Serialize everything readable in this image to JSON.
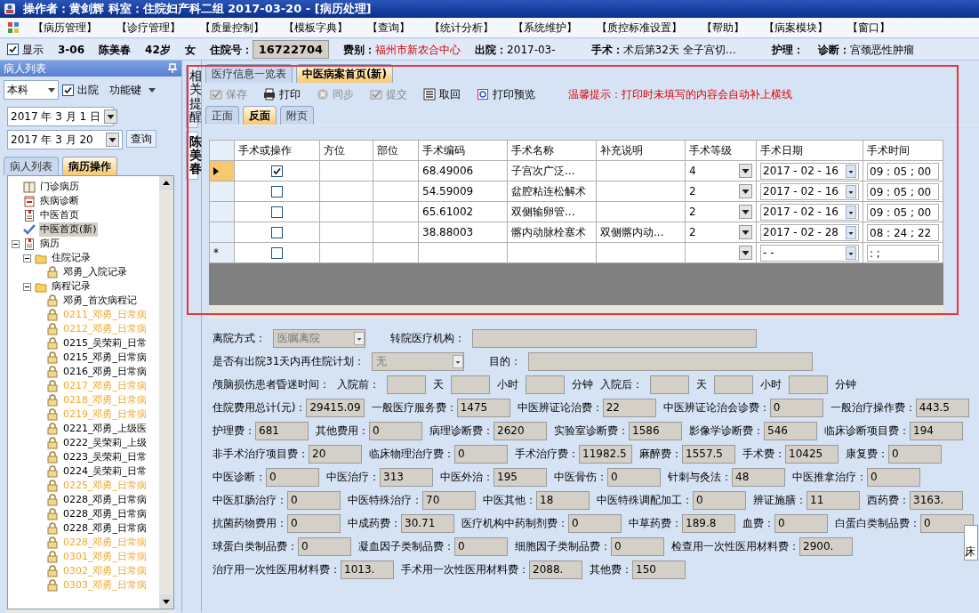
{
  "window": {
    "title": "操作者：黄剑辉  科室：住院妇产科二组  2017-03-20 - [病历处理]"
  },
  "menu": [
    "【病历管理】",
    "【诊疗管理】",
    "【质量控制】",
    "【模板字典】",
    "【查询】",
    "【统计分析】",
    "【系统维护】",
    "【质控标准设置】",
    "【帮助】",
    "【病案模块】",
    "【窗口】"
  ],
  "patient_bar": {
    "show": {
      "label": "显示",
      "checked": true
    },
    "bed": "3-06",
    "name": "陈美春",
    "age": "42岁",
    "sex": "女",
    "fields": [
      {
        "label": "住院号：",
        "value": "16722704",
        "kind": "box"
      },
      {
        "label": "费别：",
        "value": "福州市新农合中心",
        "kind": "alert"
      },
      {
        "label": "出院：",
        "value": "2017-03-",
        "kind": "text"
      },
      {
        "label": "手术：",
        "value": "术后第32天  全子宫切…",
        "kind": "text"
      },
      {
        "label": "护理：",
        "kind": "text"
      },
      {
        "label": "诊断：",
        "value": "宫颈恶性肿瘤",
        "kind": "text"
      }
    ]
  },
  "left_panel": {
    "title": "病人列表",
    "department": "本科",
    "discharged": {
      "label": "出院",
      "checked": true
    },
    "function_key": "功能键",
    "date_from": "2017 年 3 月 1 日",
    "date_to": "2017 年 3 月 20",
    "query": "查询",
    "tabs": [
      {
        "label": "病人列表",
        "selected": false
      },
      {
        "label": "病历操作",
        "selected": true
      }
    ],
    "tree": [
      {
        "text": "门诊病历",
        "kind": "book",
        "highlighted": false,
        "selected": false
      },
      {
        "text": "疾病诊断",
        "kind": "calendar",
        "highlighted": false,
        "selected": false
      },
      {
        "text": "中医首页",
        "kind": "doc",
        "highlighted": false,
        "selected": false
      },
      {
        "text": "中医首页(新)",
        "kind": "check",
        "highlighted": false,
        "selected": true
      },
      {
        "text": "病历",
        "kind": "doc",
        "highlighted": false,
        "selected": false,
        "expanded": true,
        "children": [
          {
            "text": "住院记录",
            "kind": "folder",
            "highlighted": false,
            "selected": false,
            "expanded": true,
            "children": [
              {
                "text": "邓勇_入院记录",
                "kind": "lock",
                "highlighted": false,
                "selected": false
              }
            ]
          },
          {
            "text": "病程记录",
            "kind": "folder",
            "highlighted": false,
            "selected": false,
            "expanded": true,
            "children": [
              {
                "text": "邓勇_首次病程记",
                "kind": "lock",
                "highlighted": false,
                "selected": false
              },
              {
                "text": "0211_邓勇_日常病",
                "kind": "lock",
                "highlighted": true,
                "selected": false
              },
              {
                "text": "0212_邓勇_日常病",
                "kind": "lock",
                "highlighted": true,
                "selected": false
              },
              {
                "text": "0215_吴荣莉_日常",
                "kind": "lock",
                "highlighted": false,
                "selected": false
              },
              {
                "text": "0215_邓勇_日常病",
                "kind": "lock",
                "highlighted": false,
                "selected": false
              },
              {
                "text": "0216_邓勇_日常病",
                "kind": "lock",
                "highlighted": false,
                "selected": false
              },
              {
                "text": "0217_邓勇_日常病",
                "kind": "lock",
                "highlighted": true,
                "selected": false
              },
              {
                "text": "0218_邓勇_日常病",
                "kind": "lock",
                "highlighted": true,
                "selected": false
              },
              {
                "text": "0219_邓勇_日常病",
                "kind": "lock",
                "highlighted": true,
                "selected": false
              },
              {
                "text": "0221_邓勇_上级医",
                "kind": "lock",
                "highlighted": false,
                "selected": false
              },
              {
                "text": "0222_吴荣莉_上级",
                "kind": "lock",
                "highlighted": false,
                "selected": false
              },
              {
                "text": "0223_吴荣莉_日常",
                "kind": "lock",
                "highlighted": false,
                "selected": false
              },
              {
                "text": "0224_吴荣莉_日常",
                "kind": "lock",
                "highlighted": false,
                "selected": false
              },
              {
                "text": "0225_邓勇_日常病",
                "kind": "lock",
                "highlighted": true,
                "selected": false
              },
              {
                "text": "0228_邓勇_日常病",
                "kind": "lock",
                "highlighted": false,
                "selected": false
              },
              {
                "text": "0228_邓勇_日常病",
                "kind": "lock",
                "highlighted": false,
                "selected": false
              },
              {
                "text": "0228_邓勇_日常病",
                "kind": "lock",
                "highlighted": false,
                "selected": false
              },
              {
                "text": "0228_邓勇_日常病",
                "kind": "lock",
                "highlighted": true,
                "selected": false
              },
              {
                "text": "0301_邓勇_日常病",
                "kind": "lock",
                "highlighted": true,
                "selected": false
              },
              {
                "text": "0302_邓勇_日常病",
                "kind": "lock",
                "highlighted": true,
                "selected": false
              },
              {
                "text": "0303_邓勇_日常病",
                "kind": "lock",
                "highlighted": true,
                "selected": false
              }
            ]
          }
        ]
      }
    ]
  },
  "side_tabs": [
    {
      "label": "相关提醒",
      "selected": false
    },
    {
      "label": "陈美春",
      "selected": true
    }
  ],
  "tabs": [
    {
      "label": "医疗信息一览表",
      "selected": false
    },
    {
      "label": "中医病案首页(新)",
      "selected": true
    }
  ],
  "toolbar": [
    {
      "label": "保存",
      "kind": "save",
      "disabled": true
    },
    {
      "label": "打印",
      "kind": "print",
      "disabled": false
    },
    {
      "label": "同步",
      "kind": "sync",
      "disabled": true
    },
    {
      "label": "提交",
      "kind": "save",
      "disabled": true
    },
    {
      "label": "取回",
      "kind": "fetch",
      "disabled": false
    },
    {
      "label": "打印预览",
      "kind": "preview",
      "disabled": false
    }
  ],
  "tip": "温馨提示：打印时未填写的内容会自动补上横线",
  "subtabs": [
    {
      "label": "正面",
      "selected": false
    },
    {
      "label": "反面",
      "selected": true
    },
    {
      "label": "附页",
      "selected": false
    }
  ],
  "table": {
    "columns": [
      "手术或操作",
      "方位",
      "部位",
      "手术编码",
      "手术名称",
      "补充说明",
      "手术等级",
      "手术日期",
      "手术时间"
    ],
    "rows": [
      {
        "current": true,
        "checked": true,
        "code": "68.49006",
        "name": "子宫次广泛...",
        "level": "4",
        "date": "2017 - 02 - 16",
        "time": "09 : 05 ; 00"
      },
      {
        "current": false,
        "checked": false,
        "code": "54.59009",
        "name": "盆腔粘连松解术",
        "level": "2",
        "date": "2017 - 02 - 16",
        "time": "09 : 05 ; 00"
      },
      {
        "current": false,
        "checked": false,
        "code": "65.61002",
        "name": "双侧输卵管...",
        "level": "2",
        "date": "2017 - 02 - 16",
        "time": "09 : 05 ; 00"
      },
      {
        "current": false,
        "checked": false,
        "code": "38.88003",
        "name": "髂内动脉栓塞术",
        "note": "双侧髂内动...",
        "level": "2",
        "date": "2017 - 02 - 28",
        "time": "08 : 24 ; 22"
      }
    ],
    "new_row": {
      "marker": "*",
      "checked": false,
      "date": "-  -",
      "time": ":  ;"
    }
  },
  "form_rows": [
    [
      {
        "kind": "label",
        "text": "离院方式："
      },
      {
        "kind": "select",
        "value": "医嘱离院",
        "disabled": true
      },
      {
        "kind": "label",
        "text": "转院医疗机构："
      },
      {
        "kind": "wide"
      }
    ],
    [
      {
        "kind": "label",
        "text": "是否有出院31天内再住院计划："
      },
      {
        "kind": "select",
        "value": "无",
        "disabled": true
      },
      {
        "kind": "label",
        "text": "目的："
      },
      {
        "kind": "wide"
      }
    ],
    [
      {
        "kind": "label",
        "text": "颅脑损伤患者昏迷时间："
      },
      {
        "kind": "label",
        "text": "入院前："
      },
      {
        "kind": "field"
      },
      {
        "kind": "label",
        "text": "天"
      },
      {
        "kind": "field"
      },
      {
        "kind": "label",
        "text": "小时"
      },
      {
        "kind": "field"
      },
      {
        "kind": "label",
        "text": "分钟"
      },
      {
        "kind": "label",
        "text": "入院后："
      },
      {
        "kind": "field"
      },
      {
        "kind": "label",
        "text": "天"
      },
      {
        "kind": "field"
      },
      {
        "kind": "label",
        "text": "小时"
      },
      {
        "kind": "field"
      },
      {
        "kind": "label",
        "text": "分钟"
      }
    ],
    [
      {
        "kind": "fee",
        "label": "住院费用总计(元)：",
        "value": "29415.09"
      },
      {
        "kind": "fee",
        "label": "一般医疗服务费：",
        "value": "1475"
      },
      {
        "kind": "fee",
        "label": "中医辨证论治费：",
        "value": "22"
      },
      {
        "kind": "fee",
        "label": "中医辨证论治会诊费：",
        "value": "0"
      },
      {
        "kind": "fee",
        "label": "一般治疗操作费：",
        "value": "443.5"
      }
    ],
    [
      {
        "kind": "fee",
        "label": "护理费：",
        "value": "681"
      },
      {
        "kind": "fee",
        "label": "其他费用：",
        "value": "0"
      },
      {
        "kind": "fee",
        "label": "病理诊断费：",
        "value": "2620"
      },
      {
        "kind": "fee",
        "label": "实验室诊断费：",
        "value": "1586"
      },
      {
        "kind": "fee",
        "label": "影像学诊断费：",
        "value": "546"
      },
      {
        "kind": "fee",
        "label": "临床诊断项目费：",
        "value": "194"
      }
    ],
    [
      {
        "kind": "fee",
        "label": "非手术治疗项目费：",
        "value": "20"
      },
      {
        "kind": "fee",
        "label": "临床物理治疗费：",
        "value": "0"
      },
      {
        "kind": "fee",
        "label": "手术治疗费：",
        "value": "11982.5"
      },
      {
        "kind": "fee",
        "label": "麻醉费：",
        "value": "1557.5"
      },
      {
        "kind": "fee",
        "label": "手术费：",
        "value": "10425"
      },
      {
        "kind": "fee",
        "label": "康复费：",
        "value": "0"
      }
    ],
    [
      {
        "kind": "fee",
        "label": "中医诊断：",
        "value": "0"
      },
      {
        "kind": "fee",
        "label": "中医治疗：",
        "value": "313"
      },
      {
        "kind": "fee",
        "label": "中医外治：",
        "value": "195"
      },
      {
        "kind": "fee",
        "label": "中医骨伤：",
        "value": "0"
      },
      {
        "kind": "fee",
        "label": "针刺与灸法：",
        "value": "48"
      },
      {
        "kind": "fee",
        "label": "中医推拿治疗：",
        "value": "0"
      }
    ],
    [
      {
        "kind": "fee",
        "label": "中医肛肠治疗：",
        "value": "0"
      },
      {
        "kind": "fee",
        "label": "中医特殊治疗：",
        "value": "70"
      },
      {
        "kind": "fee",
        "label": "中医其他：",
        "value": "18"
      },
      {
        "kind": "fee",
        "label": "中医特殊调配加工：",
        "value": "0"
      },
      {
        "kind": "fee",
        "label": "辨证施膳：",
        "value": "11"
      },
      {
        "kind": "fee",
        "label": "西药费：",
        "value": "3163."
      }
    ],
    [
      {
        "kind": "fee",
        "label": "抗菌药物费用：",
        "value": "0"
      },
      {
        "kind": "fee",
        "label": "中成药费：",
        "value": "30.71"
      },
      {
        "kind": "fee",
        "label": "医疗机构中药制剂费：",
        "value": "0"
      },
      {
        "kind": "fee",
        "label": "中草药费：",
        "value": "189.8"
      },
      {
        "kind": "fee",
        "label": "血费：",
        "value": "0"
      },
      {
        "kind": "fee",
        "label": "白蛋白类制品费：",
        "value": "0"
      }
    ],
    [
      {
        "kind": "fee",
        "label": "球蛋白类制品费：",
        "value": "0"
      },
      {
        "kind": "fee",
        "label": "凝血因子类制品费：",
        "value": "0"
      },
      {
        "kind": "fee",
        "label": "细胞因子类制品费：",
        "value": "0"
      },
      {
        "kind": "fee",
        "label": "检查用一次性医用材料费：",
        "value": "2900."
      }
    ],
    [
      {
        "kind": "fee",
        "label": "治疗用一次性医用材料费：",
        "value": "1013."
      },
      {
        "kind": "fee",
        "label": "手术用一次性医用材料费：",
        "value": "2088."
      },
      {
        "kind": "fee",
        "label": "其他费：",
        "value": "150"
      }
    ]
  ],
  "edge_panel": {
    "text": "床"
  }
}
